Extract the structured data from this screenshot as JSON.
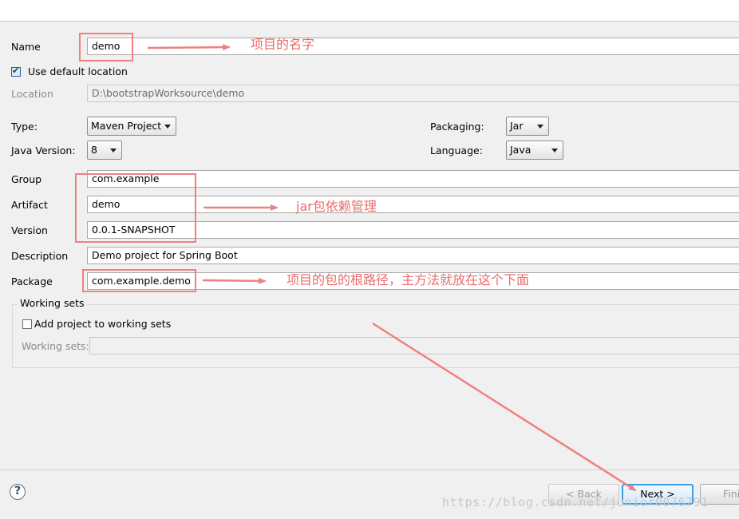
{
  "form": {
    "name_label": "Name",
    "name_value": "demo",
    "use_default_location_label": "Use default location",
    "use_default_location_checked": true,
    "location_label": "Location",
    "location_value": "D:\\bootstrapWorksource\\demo",
    "type_label": "Type:",
    "type_value": "Maven Project",
    "packaging_label": "Packaging:",
    "packaging_value": "Jar",
    "java_version_label": "Java Version:",
    "java_version_value": "8",
    "language_label": "Language:",
    "language_value": "Java",
    "group_label": "Group",
    "group_value": "com.example",
    "artifact_label": "Artifact",
    "artifact_value": "demo",
    "version_label": "Version",
    "version_value": "0.0.1-SNAPSHOT",
    "description_label": "Description",
    "description_value": "Demo project for Spring Boot",
    "package_label": "Package",
    "package_value": "com.example.demo"
  },
  "working_sets": {
    "title": "Working sets",
    "add_label": "Add project to working sets",
    "add_checked": false,
    "sets_label": "Working sets:",
    "sets_value": ""
  },
  "buttons": {
    "help": "?",
    "back": "< Back",
    "next": "Next >",
    "finish": "Fini"
  },
  "annotations": {
    "name_note": "项目的名字",
    "jar_note": "jar包依赖管理",
    "package_note": "项目的包的根路径，主方法就放在这个下面",
    "color": "#ec6b6b"
  },
  "watermark": "https://blog.csdn.net/junior0076791"
}
